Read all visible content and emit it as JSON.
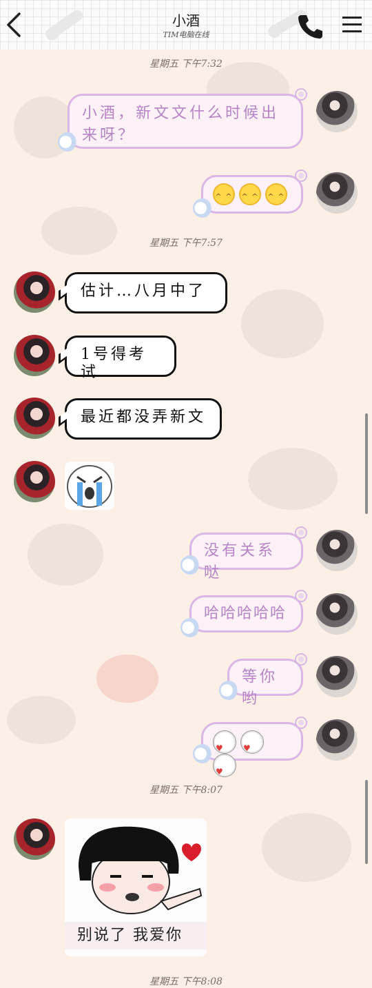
{
  "header": {
    "title": "小酒",
    "subtitle": "TIM电脑在线"
  },
  "timestamps": [
    "星期五 下午7:32",
    "星期五 下午7:57",
    "星期五 下午8:07",
    "星期五 下午8:08"
  ],
  "messages": {
    "m1": "小酒，新文文什么时候出来呀？",
    "m3": "估计…八月中了",
    "m4": "1号得考试",
    "m5": "最近都没弄新文",
    "m7": "没有关系哒",
    "m8": "哈哈哈哈哈",
    "m9": "等你哟"
  },
  "stickers": {
    "meme_caption": "别说了 我爱你"
  },
  "icons": {
    "back": "chevron-left-icon",
    "call": "phone-icon",
    "menu": "hamburger-menu-icon"
  }
}
